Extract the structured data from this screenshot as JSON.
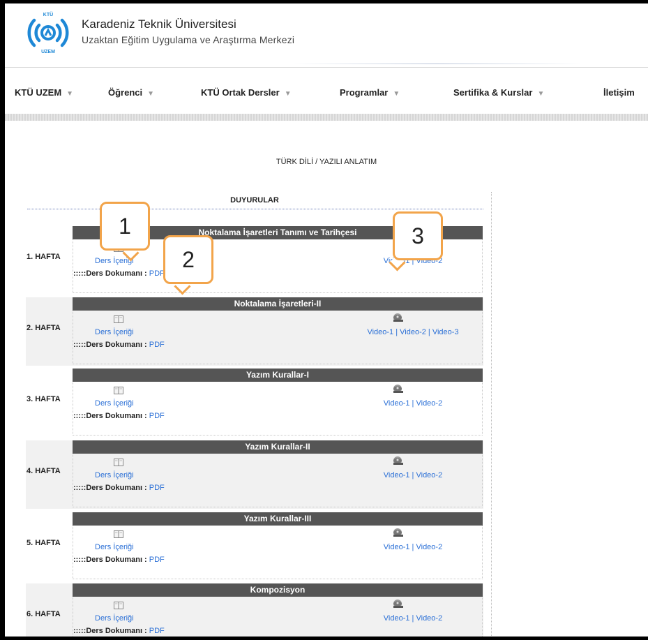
{
  "header": {
    "logo_top": "KTÜ",
    "logo_bottom": "UZEM",
    "university": "Karadeniz Teknik Üniversitesi",
    "subtitle": "Uzaktan Eğitim Uygulama ve Araştırma Merkezi"
  },
  "nav": [
    {
      "label": "KTÜ UZEM"
    },
    {
      "label": "Öğrenci"
    },
    {
      "label": "KTÜ Ortak Dersler"
    },
    {
      "label": "Programlar"
    },
    {
      "label": "Sertifika & Kurslar"
    },
    {
      "label": "İletişim"
    }
  ],
  "course_title": "TÜRK DİLİ / YAZILI ANLATIM",
  "announcements": "DUYURULAR",
  "weeks": [
    {
      "label": "1. HAFTA",
      "title": "Noktalama İşaretleri Tanımı ve Tarihçesi",
      "content_link": "Ders İçeriği",
      "doc_prefix": ":::::Ders Dokumanı : ",
      "doc_link": "PDF",
      "videos": [
        "Video-1",
        "Video-2"
      ]
    },
    {
      "label": "2. HAFTA",
      "title": "Noktalama İşaretleri-II",
      "content_link": "Ders İçeriği",
      "doc_prefix": ":::::Ders Dokumanı : ",
      "doc_link": "PDF",
      "videos": [
        "Video-1",
        "Video-2",
        "Video-3"
      ]
    },
    {
      "label": "3. HAFTA",
      "title": "Yazım Kurallar-I",
      "content_link": "Ders İçeriği",
      "doc_prefix": ":::::Ders Dokumanı : ",
      "doc_link": "PDF",
      "videos": [
        "Video-1",
        "Video-2"
      ]
    },
    {
      "label": "4. HAFTA",
      "title": "Yazım Kurallar-II",
      "content_link": "Ders İçeriği",
      "doc_prefix": ":::::Ders Dokumanı : ",
      "doc_link": "PDF",
      "videos": [
        "Video-1",
        "Video-2"
      ]
    },
    {
      "label": "5. HAFTA",
      "title": "Yazım Kurallar-III",
      "content_link": "Ders İçeriği",
      "doc_prefix": ":::::Ders Dokumanı : ",
      "doc_link": "PDF",
      "videos": [
        "Video-1",
        "Video-2"
      ]
    },
    {
      "label": "6. HAFTA",
      "title": "Kompozisyon",
      "content_link": "Ders İçeriği",
      "doc_prefix": ":::::Ders Dokumanı : ",
      "doc_link": "PDF",
      "videos": [
        "Video-1",
        "Video-2"
      ]
    }
  ],
  "callouts": [
    "1",
    "2",
    "3"
  ],
  "icons": {
    "book": "book-icon",
    "film": "film-reel-icon",
    "chevron": "chevron-down-icon",
    "logo": "wifi-signal-logo-icon"
  },
  "colors": {
    "link": "#2a6fd6",
    "title_bar": "#555555",
    "callout_border": "#f2a44a",
    "logo_blue": "#1e88d6"
  }
}
